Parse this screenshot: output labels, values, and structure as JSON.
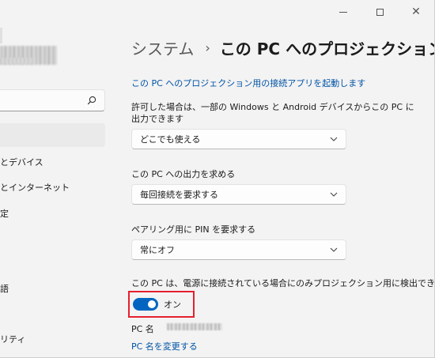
{
  "window": {
    "caption": {
      "minimize": "—",
      "maximize": "☐",
      "close": "✕"
    }
  },
  "nav": {
    "search": {
      "value": "",
      "placeholder": ""
    },
    "items": [
      {
        "label": ""
      },
      {
        "label": "とデバイス"
      },
      {
        "label": "とインターネット"
      },
      {
        "label": "定"
      },
      {
        "label": "語"
      },
      {
        "label": "リティ"
      }
    ]
  },
  "breadcrumb": {
    "parent": "システム",
    "separator": "›",
    "current": "この PC へのプロジェクション"
  },
  "main": {
    "launch_link": "この PC へのプロジェクション用の接続アプリを起動します",
    "setting1": {
      "label": "許可した場合は、一部の Windows と Android デバイスからこの PC に出力できます",
      "value": "どこでも使える"
    },
    "setting2": {
      "label": "この PC への出力を求める",
      "value": "毎回接続を要求する"
    },
    "setting3": {
      "label": "ペアリング用に PIN を要求する",
      "value": "常にオフ"
    },
    "detect": {
      "label": "この PC は、電源に接続されている場合にのみプロジェクション用に検出できます",
      "toggle_state": "オン",
      "toggle_on": true
    },
    "pc_name": {
      "label": "PC 名",
      "rename_link": "PC 名を変更する"
    }
  },
  "colors": {
    "accent": "#0065c0",
    "link": "#0053a6",
    "highlight": "#e5202e"
  }
}
